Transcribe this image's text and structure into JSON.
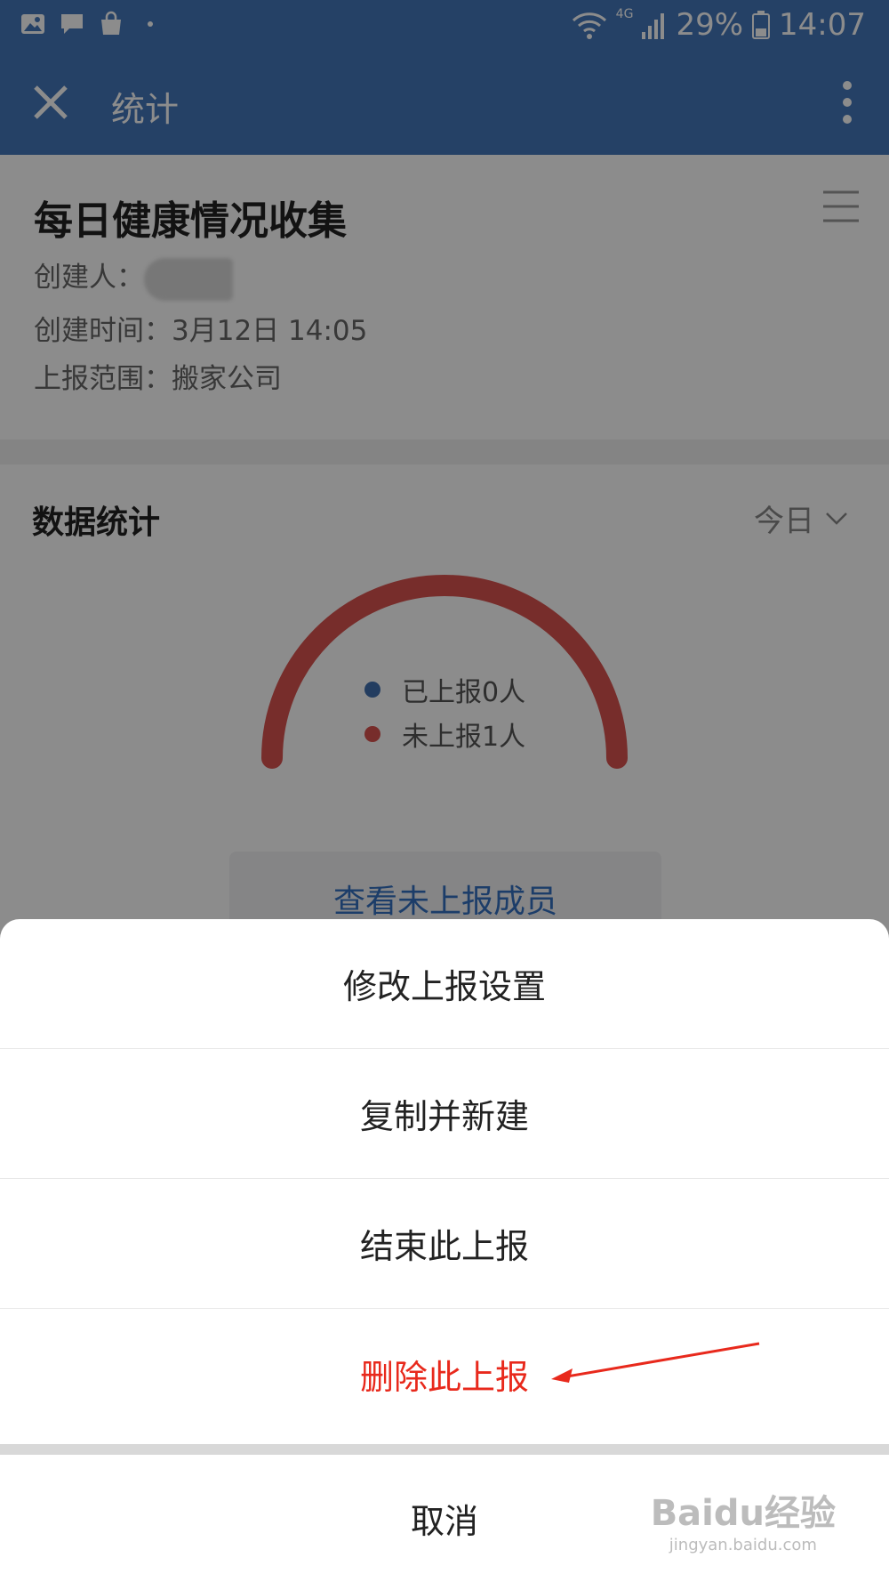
{
  "status_bar": {
    "icons_left": [
      "image-icon",
      "chat-icon",
      "bag-icon",
      "dot-icon"
    ],
    "network": "4G",
    "battery": "29%",
    "time": "14:07"
  },
  "app_bar": {
    "title": "统计"
  },
  "report": {
    "title": "每日健康情况收集",
    "creator_label": "创建人：",
    "created_time": "创建时间：3月12日 14:05",
    "scope": "上报范围：搬家公司"
  },
  "stats": {
    "title": "数据统计",
    "period": "今日",
    "legend": [
      {
        "label": "已上报0人",
        "color": "#4070b0"
      },
      {
        "label": "未上报1人",
        "color": "#d9534f"
      }
    ],
    "reported": 0,
    "not_reported": 1,
    "view_button": "查看未上报成员"
  },
  "action_sheet": {
    "options": [
      {
        "label": "修改上报设置",
        "danger": false
      },
      {
        "label": "复制并新建",
        "danger": false
      },
      {
        "label": "结束此上报",
        "danger": false
      },
      {
        "label": "删除此上报",
        "danger": true
      }
    ],
    "cancel": "取消"
  },
  "watermark": {
    "brand": "Baidu经验",
    "url": "jingyan.baidu.com"
  },
  "colors": {
    "primary": "#4477bb",
    "danger": "#e8291c",
    "gauge": "#d9534f"
  }
}
